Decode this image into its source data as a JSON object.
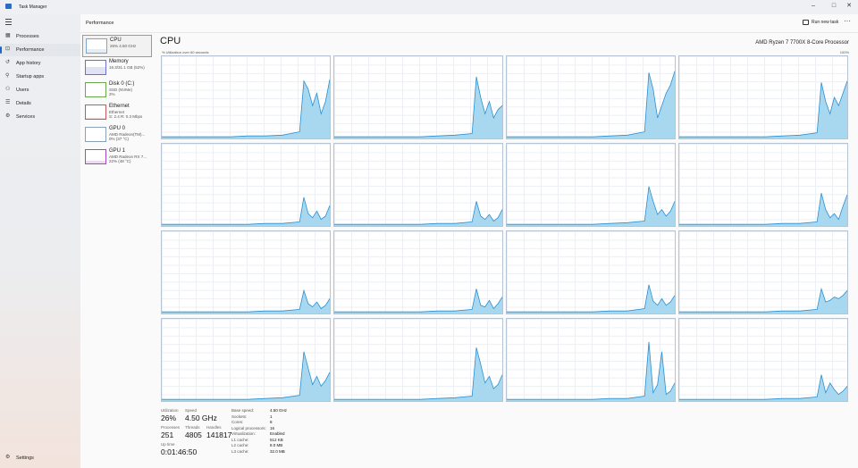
{
  "window": {
    "title": "Task Manager",
    "controls": {
      "minimize": "–",
      "maximize": "□",
      "close": "✕"
    }
  },
  "nav": {
    "items": [
      {
        "label": "Processes",
        "icon": "processes-icon",
        "glyph": "▦"
      },
      {
        "label": "Performance",
        "icon": "performance-icon",
        "glyph": "⊡",
        "active": true
      },
      {
        "label": "App history",
        "icon": "app-history-icon",
        "glyph": "↺"
      },
      {
        "label": "Startup apps",
        "icon": "startup-apps-icon",
        "glyph": "⚲"
      },
      {
        "label": "Users",
        "icon": "users-icon",
        "glyph": "⚇"
      },
      {
        "label": "Details",
        "icon": "details-icon",
        "glyph": "☰"
      },
      {
        "label": "Services",
        "icon": "services-icon",
        "glyph": "⚙"
      }
    ],
    "settings": {
      "label": "Settings",
      "icon": "settings-icon",
      "glyph": "⚙"
    }
  },
  "header": {
    "title": "Performance",
    "run_new_task": "Run new task",
    "more": "···"
  },
  "resources": [
    {
      "name": "CPU",
      "sub": "26% 4.50 GHz",
      "sub2": "",
      "active": true,
      "color": "#7aa5cf",
      "fill": 0.26
    },
    {
      "name": "Memory",
      "sub": "16.3/31.1 GB (52%)",
      "sub2": "",
      "color": "#6a6fd1",
      "fill": 0.52
    },
    {
      "name": "Disk 0 (C:)",
      "sub": "SSD (NVMe)",
      "sub2": "2%",
      "color": "#6aa84f",
      "fill": 0.02
    },
    {
      "name": "Ethernet",
      "sub": "Ethernet",
      "sub2": "S: 2.4 R: 0.3 Mbps",
      "color": "#c05a5a",
      "fill": 0.05
    },
    {
      "name": "GPU 0",
      "sub": "AMD Radeon(TM)...",
      "sub2": "0% (37 °C)",
      "color": "#8aa2b8",
      "fill": 0.0
    },
    {
      "name": "GPU 1",
      "sub": "AMD Radeon RX 7...",
      "sub2": "22% (48 °C)",
      "color": "#a24cc4",
      "fill": 0.22
    }
  ],
  "cpu": {
    "title": "CPU",
    "processor": "AMD Ryzen 7 7700X 8-Core Processor",
    "axis_label": "% Utilization over 60 seconds",
    "axis_max": "100%",
    "graph_color": "#a8d8ef",
    "graph_line": "#2b8fd1",
    "cores": [
      [
        2,
        2,
        2,
        2,
        2,
        3,
        3,
        4,
        8,
        70,
        60,
        40,
        55,
        30,
        45,
        72
      ],
      [
        2,
        2,
        2,
        2,
        2,
        2,
        3,
        4,
        6,
        75,
        50,
        30,
        45,
        25,
        35,
        40
      ],
      [
        2,
        2,
        2,
        2,
        2,
        2,
        3,
        4,
        8,
        80,
        60,
        25,
        40,
        55,
        65,
        82
      ],
      [
        2,
        2,
        2,
        2,
        2,
        2,
        3,
        4,
        7,
        68,
        45,
        30,
        50,
        40,
        55,
        70
      ],
      [
        2,
        2,
        2,
        2,
        2,
        2,
        3,
        3,
        5,
        35,
        15,
        10,
        18,
        8,
        12,
        25
      ],
      [
        2,
        2,
        2,
        2,
        2,
        2,
        3,
        3,
        5,
        30,
        12,
        8,
        14,
        6,
        10,
        20
      ],
      [
        2,
        2,
        2,
        2,
        2,
        2,
        3,
        4,
        6,
        48,
        30,
        14,
        20,
        12,
        18,
        30
      ],
      [
        2,
        2,
        2,
        2,
        2,
        2,
        3,
        3,
        5,
        40,
        20,
        10,
        15,
        8,
        24,
        38
      ],
      [
        2,
        2,
        2,
        2,
        2,
        2,
        3,
        3,
        5,
        28,
        12,
        8,
        14,
        6,
        10,
        18
      ],
      [
        2,
        2,
        2,
        2,
        2,
        2,
        3,
        3,
        5,
        30,
        10,
        8,
        16,
        6,
        12,
        20
      ],
      [
        2,
        2,
        2,
        2,
        2,
        2,
        3,
        3,
        6,
        35,
        15,
        10,
        18,
        10,
        14,
        22
      ],
      [
        2,
        2,
        2,
        2,
        2,
        2,
        3,
        3,
        5,
        30,
        14,
        16,
        20,
        18,
        22,
        28
      ],
      [
        2,
        2,
        2,
        2,
        2,
        2,
        3,
        4,
        7,
        60,
        40,
        20,
        30,
        18,
        25,
        35
      ],
      [
        2,
        2,
        2,
        2,
        2,
        2,
        3,
        4,
        6,
        65,
        45,
        22,
        30,
        15,
        20,
        32
      ],
      [
        2,
        2,
        2,
        2,
        2,
        2,
        3,
        3,
        6,
        72,
        10,
        20,
        60,
        8,
        12,
        22
      ],
      [
        2,
        2,
        2,
        2,
        2,
        2,
        3,
        3,
        5,
        32,
        10,
        22,
        14,
        8,
        12,
        18
      ]
    ],
    "stats": {
      "utilization": {
        "label": "Utilization",
        "value": "26%"
      },
      "speed": {
        "label": "Speed",
        "value": "4.50 GHz"
      },
      "processes": {
        "label": "Processes",
        "value": "251"
      },
      "threads": {
        "label": "Threads",
        "value": "4805"
      },
      "handles": {
        "label": "Handles",
        "value": "141817"
      },
      "uptime": {
        "label": "Up time",
        "value": "0:01:46:50"
      }
    },
    "specs": [
      {
        "k": "Base speed:",
        "v": "4.50 GHz"
      },
      {
        "k": "Sockets:",
        "v": "1"
      },
      {
        "k": "Cores:",
        "v": "8"
      },
      {
        "k": "Logical processors:",
        "v": "16"
      },
      {
        "k": "Virtualization:",
        "v": "Enabled"
      },
      {
        "k": "L1 cache:",
        "v": "512 KB"
      },
      {
        "k": "L2 cache:",
        "v": "8.0 MB"
      },
      {
        "k": "L3 cache:",
        "v": "32.0 MB"
      }
    ]
  }
}
